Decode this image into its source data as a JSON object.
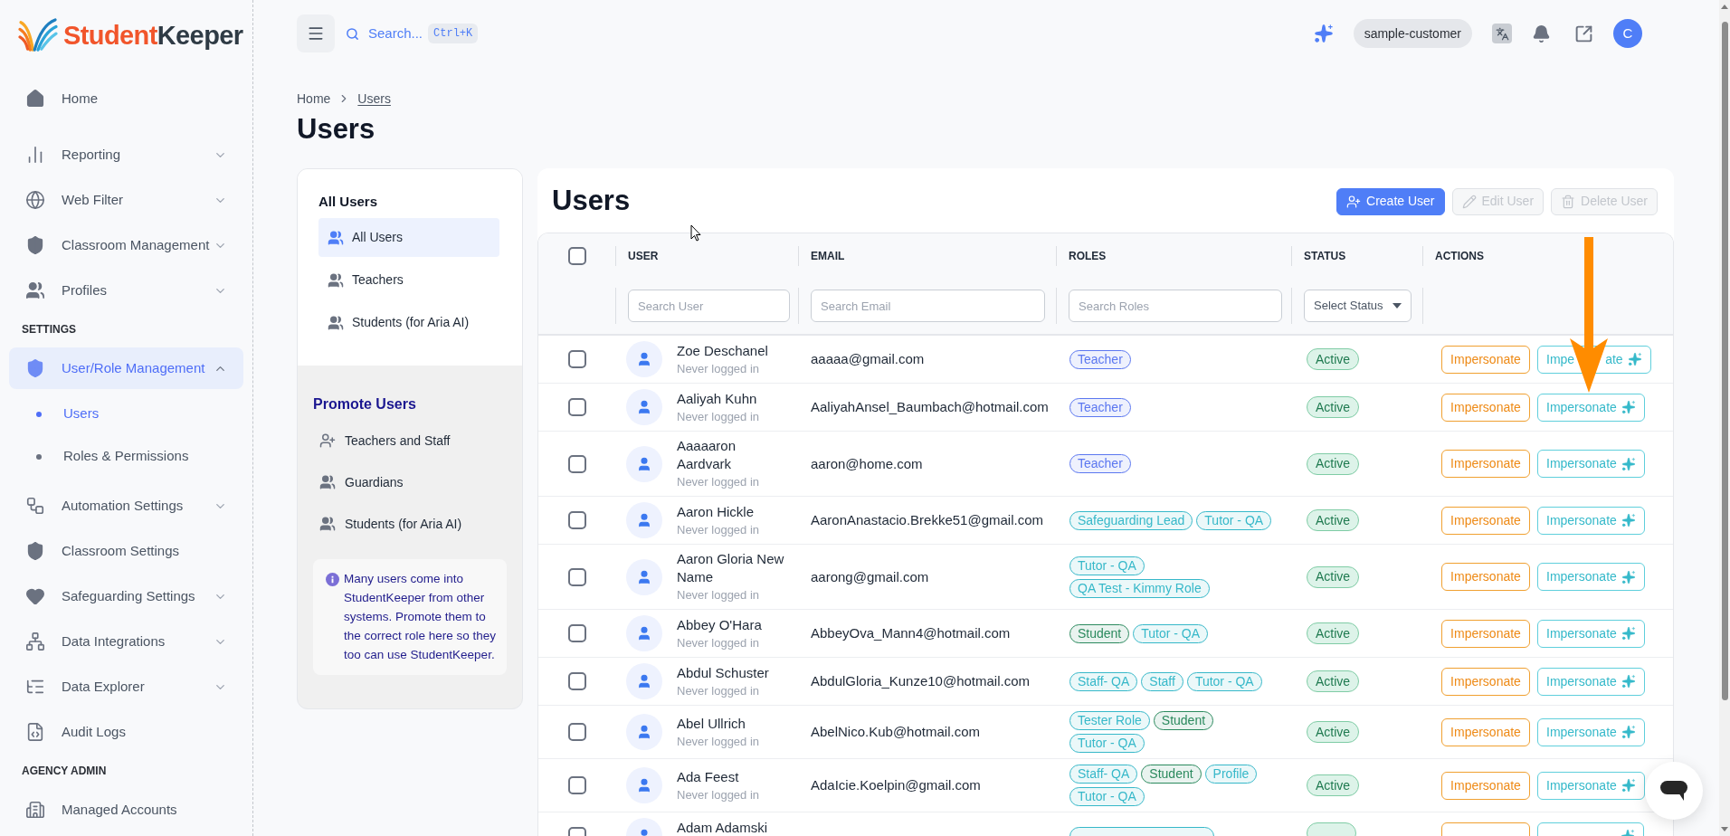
{
  "logo": {
    "text_1": "Student",
    "text_2": "Keeper"
  },
  "sidebar": {
    "sections": [
      {
        "items": [
          {
            "label": "Home",
            "selected": false
          }
        ]
      },
      {
        "items": [
          {
            "label": "Reporting",
            "selected": false,
            "expanded": false
          },
          {
            "label": "Web Filter",
            "selected": false,
            "expanded": false
          },
          {
            "label": "Classroom Management",
            "selected": false,
            "expanded": false
          },
          {
            "label": "Profiles",
            "selected": false,
            "expanded": false
          }
        ]
      },
      {
        "heading": "SETTINGS",
        "items": [
          {
            "label": "User/Role Management",
            "selected": true,
            "expanded": true,
            "children": [
              {
                "label": "Users",
                "selected": true
              },
              {
                "label": "Roles & Permissions",
                "selected": false
              }
            ]
          },
          {
            "label": "Automation Settings",
            "selected": false,
            "expanded": false
          },
          {
            "label": "Classroom Settings",
            "selected": false
          },
          {
            "label": "Safeguarding Settings",
            "selected": false,
            "expanded": false
          },
          {
            "label": "Data Integrations",
            "selected": false,
            "expanded": false
          },
          {
            "label": "Data Explorer",
            "selected": false,
            "expanded": false
          },
          {
            "label": "Audit Logs",
            "selected": false
          }
        ]
      },
      {
        "heading": "AGENCY ADMIN",
        "items": [
          {
            "label": "Managed Accounts",
            "selected": false
          }
        ]
      }
    ]
  },
  "top_bar": {
    "search_label": "Search...",
    "shortcut": "Ctrl+K",
    "account": "sample-customer",
    "avatar_initial": "C"
  },
  "breadcrumb": [
    {
      "label": "Home",
      "current": false
    },
    {
      "label": "Users",
      "current": true
    }
  ],
  "page_title": "Users",
  "groups_panel": {
    "heading": "All Users",
    "items": [
      {
        "label": "All Users",
        "selected": true
      },
      {
        "label": "Teachers",
        "selected": false
      },
      {
        "label": "Students (for Aria AI)",
        "selected": false
      }
    ],
    "promote_heading": "Promote Users",
    "promote_items": [
      {
        "label": "Teachers and Staff",
        "selected": false
      },
      {
        "label": "Guardians",
        "selected": false
      },
      {
        "label": "Students (for Aria AI)",
        "selected": false
      }
    ],
    "info": "Many users come into StudentKeeper from other systems. Promote them to the correct role here so they too can use StudentKeeper."
  },
  "users_card": {
    "title": "Users",
    "buttons": [
      {
        "label": "Create User",
        "disabled": false
      },
      {
        "label": "Edit User",
        "disabled": true
      },
      {
        "label": "Delete User",
        "disabled": true
      }
    ]
  },
  "table": {
    "select_all_checked": false,
    "columns": [
      "USER",
      "EMAIL",
      "ROLES",
      "STATUS",
      "ACTIONS"
    ],
    "filters": [
      {
        "kind": "text",
        "placeholder": "Search User"
      },
      {
        "kind": "text",
        "placeholder": "Search Email"
      },
      {
        "kind": "text",
        "placeholder": "Search Roles"
      },
      {
        "kind": "select",
        "placeholder": "Select Status"
      }
    ],
    "rows": [
      {
        "checked": false,
        "name": "Zoe Deschanel",
        "last_login": "Never logged in",
        "email": "aaaaa@gmail.com",
        "roles": [
          {
            "label": "Teacher",
            "color": "#5b77f0"
          }
        ],
        "status": "Active",
        "actions": [
          {
            "kind": "standard",
            "label": "Impersonate"
          },
          {
            "kind": "ai",
            "label_parts": [
              "Impe",
              "ate"
            ]
          }
        ]
      },
      {
        "checked": false,
        "name": "Aaliyah Kuhn",
        "last_login": "Never logged in",
        "email": "AaliyahAnsel_Baumbach@hotmail.com",
        "roles": [
          {
            "label": "Teacher",
            "color": "#5b77f0"
          }
        ],
        "status": "Active",
        "actions": [
          {
            "kind": "standard",
            "label": "Impersonate"
          },
          {
            "kind": "ai",
            "label": "Impersonate"
          }
        ]
      },
      {
        "checked": false,
        "name": "Aaaaaron Aardvark",
        "last_login": "Never logged in",
        "email": "aaron@home.com",
        "roles": [
          {
            "label": "Teacher",
            "color": "#5b77f0"
          }
        ],
        "status": "Active",
        "actions": [
          {
            "kind": "standard",
            "label": "Impersonate"
          },
          {
            "kind": "ai",
            "label": "Impersonate"
          }
        ]
      },
      {
        "checked": false,
        "name": "Aaron Hickle",
        "last_login": "Never logged in",
        "email": "AaronAnastacio.Brekke51@gmail.com",
        "roles": [
          {
            "label": "Safeguarding Lead",
            "color": "#36b8c9"
          },
          {
            "label": "Tutor - QA",
            "color": "#36b8c9"
          }
        ],
        "status": "Active",
        "actions": [
          {
            "kind": "standard",
            "label": "Impersonate"
          },
          {
            "kind": "ai",
            "label": "Impersonate"
          }
        ]
      },
      {
        "checked": false,
        "name": "Aaron Gloria New Name",
        "last_login": "Never logged in",
        "email": "aarong@gmail.com",
        "roles": [
          {
            "label": "Tutor - QA",
            "color": "#36b8c9"
          },
          {
            "label": "QA Test - Kimmy Role",
            "color": "#36b8c9"
          }
        ],
        "status": "Active",
        "actions": [
          {
            "kind": "standard",
            "label": "Impersonate"
          },
          {
            "kind": "ai",
            "label": "Impersonate"
          }
        ]
      },
      {
        "checked": false,
        "name": "Abbey O'Hara",
        "last_login": "Never logged in",
        "email": "AbbeyOva_Mann4@hotmail.com",
        "roles": [
          {
            "label": "Student",
            "color": "#2b8a5e"
          },
          {
            "label": "Tutor - QA",
            "color": "#36b8c9"
          }
        ],
        "status": "Active",
        "actions": [
          {
            "kind": "standard",
            "label": "Impersonate"
          },
          {
            "kind": "ai",
            "label": "Impersonate"
          }
        ]
      },
      {
        "checked": false,
        "name": "Abdul Schuster",
        "last_login": "Never logged in",
        "email": "AbdulGloria_Kunze10@hotmail.com",
        "roles": [
          {
            "label": "Staff- QA",
            "color": "#36b8c9"
          },
          {
            "label": "Staff",
            "color": "#36b8c9"
          },
          {
            "label": "Tutor - QA",
            "color": "#36b8c9"
          }
        ],
        "status": "Active",
        "actions": [
          {
            "kind": "standard",
            "label": "Impersonate"
          },
          {
            "kind": "ai",
            "label": "Impersonate"
          }
        ]
      },
      {
        "checked": false,
        "name": "Abel Ullrich",
        "last_login": "Never logged in",
        "email": "AbelNico.Kub@hotmail.com",
        "roles": [
          {
            "label": "Tester Role",
            "color": "#36b8c9"
          },
          {
            "label": "Student",
            "color": "#2b8a5e"
          },
          {
            "label": "Tutor - QA",
            "color": "#36b8c9"
          }
        ],
        "status": "Active",
        "actions": [
          {
            "kind": "standard",
            "label": "Impersonate"
          },
          {
            "kind": "ai",
            "label": "Impersonate"
          }
        ]
      },
      {
        "checked": false,
        "name": "Ada Feest",
        "last_login": "Never logged in",
        "email": "AdaIcie.Koelpin@gmail.com",
        "roles": [
          {
            "label": "Staff- QA",
            "color": "#36b8c9"
          },
          {
            "label": "Student",
            "color": "#2b8a5e"
          },
          {
            "label": "Profile",
            "color": "#36b8c9"
          },
          {
            "label": "Tutor - QA",
            "color": "#36b8c9"
          }
        ],
        "status": "Active",
        "actions": [
          {
            "kind": "standard",
            "label": "Impersonate"
          },
          {
            "kind": "ai",
            "label": "Impersonate"
          }
        ]
      },
      {
        "checked": false,
        "name": "Adam Adamski",
        "roles": [
          {
            "color": "#36b8c9"
          }
        ],
        "actions": [
          {
            "kind": "standard"
          },
          {
            "kind": "ai"
          }
        ]
      }
    ]
  }
}
